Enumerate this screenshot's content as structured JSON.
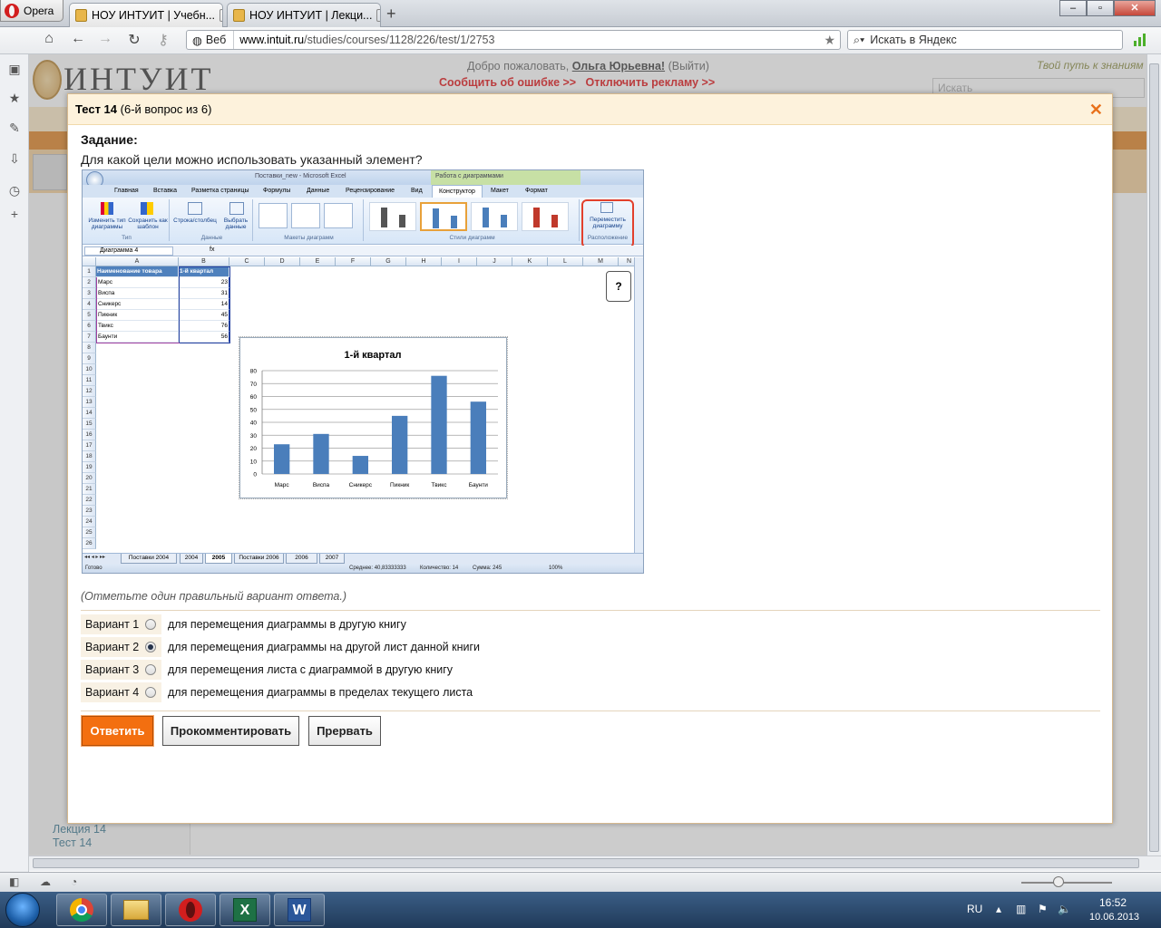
{
  "browser": {
    "menu_label": "Opera",
    "tabs": [
      {
        "title": "НОУ ИНТУИТ | Учебн..."
      },
      {
        "title": "НОУ ИНТУИТ | Лекци..."
      }
    ],
    "address_prefix": "Веб",
    "url_host": "www.intuit.ru",
    "url_path": "/studies/courses/1128/226/test/1/2753",
    "search_placeholder": "Искать в Яндекс"
  },
  "site": {
    "logo": "ИНТУИТ",
    "welcome_prefix": "Добро пожаловать,",
    "user": "Ольга Юрьевна!",
    "logout": "(Выйти)",
    "report_error": "Сообщить об ошибке >>",
    "disable_ads": "Отключить рекламу >>",
    "slogan": "Твой путь к знаниям",
    "search_placeholder": "Искать",
    "side_bottom": [
      "Лекция 14",
      "Тест 14"
    ]
  },
  "modal": {
    "title": "Тест 14",
    "subtitle": "(6-й вопрос из 6)",
    "task_label": "Задание:",
    "question": "Для какой цели можно использовать указанный элемент?",
    "hint": "(Отметьте один правильный вариант ответа.)",
    "options": [
      {
        "label": "Вариант 1",
        "text": "для перемещения диаграммы в другую книгу",
        "selected": false
      },
      {
        "label": "Вариант 2",
        "text": "для перемещения диаграммы на другой лист данной книги",
        "selected": true
      },
      {
        "label": "Вариант 3",
        "text": "для перемещения листа с диаграммой в другую книгу",
        "selected": false
      },
      {
        "label": "Вариант 4",
        "text": "для перемещения диаграммы в пределах текущего листа",
        "selected": false
      }
    ],
    "buttons": {
      "submit": "Ответить",
      "comment": "Прокомментировать",
      "abort": "Прервать"
    }
  },
  "excel": {
    "window_title": "Поставки_new - Microsoft Excel",
    "context_title": "Работа с диаграммами",
    "ribbon_tabs": [
      "Главная",
      "Вставка",
      "Разметка страницы",
      "Формулы",
      "Данные",
      "Рецензирование",
      "Вид",
      "Конструктор",
      "Макет",
      "Формат"
    ],
    "groups": {
      "type": "Тип",
      "data": "Данные",
      "layouts": "Макеты диаграмм",
      "styles": "Стили диаграмм",
      "location": "Расположение"
    },
    "buttons": {
      "change_type": "Изменить тип диаграммы",
      "save_template": "Сохранить как шаблон",
      "row_col": "Строка/столбец",
      "select_data": "Выбрать данные",
      "move_chart": "Переместить диаграмму"
    },
    "name_box": "Диаграмма 4",
    "columns": [
      "A",
      "B",
      "C",
      "D",
      "E",
      "F",
      "G",
      "H",
      "I",
      "J",
      "K",
      "L",
      "M",
      "N"
    ],
    "table_header": [
      "Наименование товара",
      "1-й квартал"
    ],
    "rows": [
      [
        "Марс",
        "23"
      ],
      [
        "Виспа",
        "31"
      ],
      [
        "Сникерс",
        "14"
      ],
      [
        "Пикник",
        "45"
      ],
      [
        "Твикс",
        "76"
      ],
      [
        "Баунти",
        "56"
      ]
    ],
    "sheet_tabs": [
      "Поставки 2004",
      "2004",
      "2005",
      "Поставки 2006",
      "2006",
      "2007"
    ],
    "active_sheet": "2005",
    "status": {
      "ready": "Готово",
      "avg": "Среднее: 40,83333333",
      "count": "Количество: 14",
      "sum": "Сумма: 245",
      "zoom": "100%"
    },
    "callout": "?"
  },
  "chart_data": {
    "type": "bar",
    "title": "1-й квартал",
    "categories": [
      "Марс",
      "Виспа",
      "Сникерс",
      "Пикник",
      "Твикс",
      "Баунти"
    ],
    "values": [
      23,
      31,
      14,
      45,
      76,
      56
    ],
    "ylim": [
      0,
      80
    ],
    "yticks": [
      0,
      10,
      20,
      30,
      40,
      50,
      60,
      70,
      80
    ],
    "grid": true,
    "color": "#4a7ebb"
  },
  "taskbar": {
    "lang": "RU",
    "time": "16:52",
    "date": "10.06.2013"
  }
}
